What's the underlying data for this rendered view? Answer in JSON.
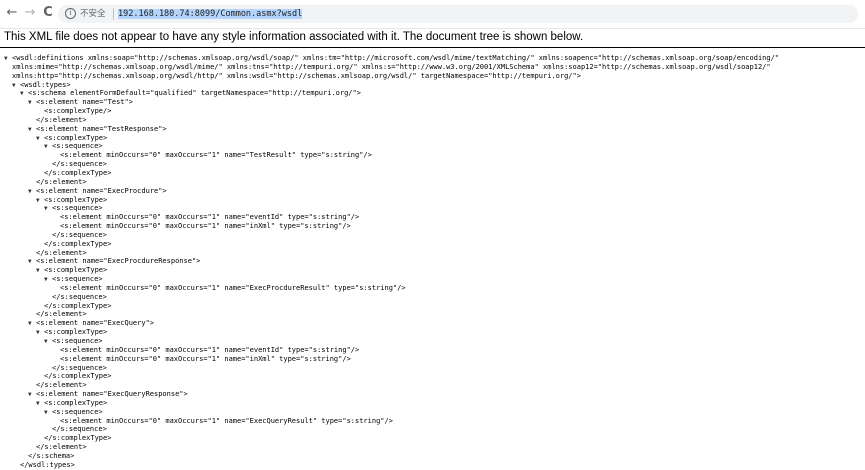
{
  "toolbar": {
    "back_icon": "←",
    "forward_icon": "→",
    "reload_icon": "C",
    "info_icon": "i",
    "security_label": "不安全",
    "url": "192.168.180.74:8099/Common.asmx?wsdl"
  },
  "banner": "This XML file does not appear to have any style information associated with it. The document tree is shown below.",
  "xml_lines": [
    {
      "indent": 0,
      "arrow": true,
      "text": "<wsdl:definitions xmlns:soap=\"http://schemas.xmlsoap.org/wsdl/soap/\" xmlns:tm=\"http://microsoft.com/wsdl/mime/textMatching/\" xmlns:soapenc=\"http://schemas.xmlsoap.org/soap/encoding/\""
    },
    {
      "indent": 0,
      "arrow": false,
      "text": "xmlns:mime=\"http://schemas.xmlsoap.org/wsdl/mime/\" xmlns:tns=\"http://tempuri.org/\" xmlns:s=\"http://www.w3.org/2001/XMLSchema\" xmlns:soap12=\"http://schemas.xmlsoap.org/wsdl/soap12/\""
    },
    {
      "indent": 0,
      "arrow": false,
      "text": "xmlns:http=\"http://schemas.xmlsoap.org/wsdl/http/\" xmlns:wsdl=\"http://schemas.xmlsoap.org/wsdl/\" targetNamespace=\"http://tempuri.org/\">"
    },
    {
      "indent": 1,
      "arrow": true,
      "text": "<wsdl:types>"
    },
    {
      "indent": 2,
      "arrow": true,
      "text": "<s:schema elementFormDefault=\"qualified\" targetNamespace=\"http://tempuri.org/\">"
    },
    {
      "indent": 3,
      "arrow": true,
      "text": "<s:element name=\"Test\">"
    },
    {
      "indent": 4,
      "arrow": false,
      "text": "<s:complexType/>"
    },
    {
      "indent": 3,
      "arrow": false,
      "text": "</s:element>"
    },
    {
      "indent": 3,
      "arrow": true,
      "text": "<s:element name=\"TestResponse\">"
    },
    {
      "indent": 4,
      "arrow": true,
      "text": "<s:complexType>"
    },
    {
      "indent": 5,
      "arrow": true,
      "text": "<s:sequence>"
    },
    {
      "indent": 6,
      "arrow": false,
      "text": "<s:element minOccurs=\"0\" maxOccurs=\"1\" name=\"TestResult\" type=\"s:string\"/>"
    },
    {
      "indent": 5,
      "arrow": false,
      "text": "</s:sequence>"
    },
    {
      "indent": 4,
      "arrow": false,
      "text": "</s:complexType>"
    },
    {
      "indent": 3,
      "arrow": false,
      "text": "</s:element>"
    },
    {
      "indent": 3,
      "arrow": true,
      "text": "<s:element name=\"ExecProcdure\">"
    },
    {
      "indent": 4,
      "arrow": true,
      "text": "<s:complexType>"
    },
    {
      "indent": 5,
      "arrow": true,
      "text": "<s:sequence>"
    },
    {
      "indent": 6,
      "arrow": false,
      "text": "<s:element minOccurs=\"0\" maxOccurs=\"1\" name=\"eventId\" type=\"s:string\"/>"
    },
    {
      "indent": 6,
      "arrow": false,
      "text": "<s:element minOccurs=\"0\" maxOccurs=\"1\" name=\"inXml\" type=\"s:string\"/>"
    },
    {
      "indent": 5,
      "arrow": false,
      "text": "</s:sequence>"
    },
    {
      "indent": 4,
      "arrow": false,
      "text": "</s:complexType>"
    },
    {
      "indent": 3,
      "arrow": false,
      "text": "</s:element>"
    },
    {
      "indent": 3,
      "arrow": true,
      "text": "<s:element name=\"ExecProcdureResponse\">"
    },
    {
      "indent": 4,
      "arrow": true,
      "text": "<s:complexType>"
    },
    {
      "indent": 5,
      "arrow": true,
      "text": "<s:sequence>"
    },
    {
      "indent": 6,
      "arrow": false,
      "text": "<s:element minOccurs=\"0\" maxOccurs=\"1\" name=\"ExecProcdureResult\" type=\"s:string\"/>"
    },
    {
      "indent": 5,
      "arrow": false,
      "text": "</s:sequence>"
    },
    {
      "indent": 4,
      "arrow": false,
      "text": "</s:complexType>"
    },
    {
      "indent": 3,
      "arrow": false,
      "text": "</s:element>"
    },
    {
      "indent": 3,
      "arrow": true,
      "text": "<s:element name=\"ExecQuery\">"
    },
    {
      "indent": 4,
      "arrow": true,
      "text": "<s:complexType>"
    },
    {
      "indent": 5,
      "arrow": true,
      "text": "<s:sequence>"
    },
    {
      "indent": 6,
      "arrow": false,
      "text": "<s:element minOccurs=\"0\" maxOccurs=\"1\" name=\"eventId\" type=\"s:string\"/>"
    },
    {
      "indent": 6,
      "arrow": false,
      "text": "<s:element minOccurs=\"0\" maxOccurs=\"1\" name=\"inXml\" type=\"s:string\"/>"
    },
    {
      "indent": 5,
      "arrow": false,
      "text": "</s:sequence>"
    },
    {
      "indent": 4,
      "arrow": false,
      "text": "</s:complexType>"
    },
    {
      "indent": 3,
      "arrow": false,
      "text": "</s:element>"
    },
    {
      "indent": 3,
      "arrow": true,
      "text": "<s:element name=\"ExecQueryResponse\">"
    },
    {
      "indent": 4,
      "arrow": true,
      "text": "<s:complexType>"
    },
    {
      "indent": 5,
      "arrow": true,
      "text": "<s:sequence>"
    },
    {
      "indent": 6,
      "arrow": false,
      "text": "<s:element minOccurs=\"0\" maxOccurs=\"1\" name=\"ExecQueryResult\" type=\"s:string\"/>"
    },
    {
      "indent": 5,
      "arrow": false,
      "text": "</s:sequence>"
    },
    {
      "indent": 4,
      "arrow": false,
      "text": "</s:complexType>"
    },
    {
      "indent": 3,
      "arrow": false,
      "text": "</s:element>"
    },
    {
      "indent": 2,
      "arrow": false,
      "text": "</s:schema>"
    },
    {
      "indent": 1,
      "arrow": false,
      "text": "</wsdl:types>"
    }
  ]
}
